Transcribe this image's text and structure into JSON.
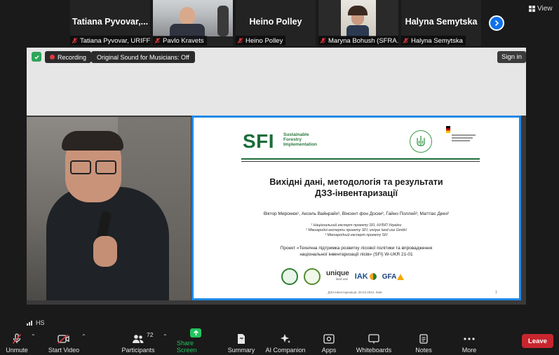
{
  "gallery": {
    "tiles": [
      {
        "big_name": "Tatiana  Pyvovar,...",
        "caption": "Tatiana Pyvovar, URIFF..."
      },
      {
        "big_name": "",
        "caption": "Pavlo Kravets"
      },
      {
        "big_name": "Heino Polley",
        "caption": "Heino Polley"
      },
      {
        "big_name": "",
        "caption": "Maryna Bohush (SFRA..."
      },
      {
        "big_name": "Halyna Semytska",
        "caption": "Halyna Semytska"
      }
    ],
    "view_label": "View"
  },
  "stage": {
    "recording_label": "Recording",
    "original_sound_label": "Original Sound for Musicians: Off",
    "signin_label": "Sign in",
    "hs_label": "HS"
  },
  "slide": {
    "logo_text": "SFI",
    "logo_sub": [
      "Sustainable",
      "Forestry",
      "Implementation"
    ],
    "title_line1": "Вихідні дані, методологія та результати",
    "title_line2": "ДЗЗ-інвентаризації",
    "authors": "Віктор Миронюк¹, Аксель Вайнрайх², Вінсент фон Доски², Гайно Поллей³, Маттіас Деез²",
    "affil1": "¹ Національний експерт проекту SFI, НУБіП України",
    "affil2": "² Міжнародні експерти проекту SFI, unique land use GmbH",
    "affil3": "³ Міжнародний експерт проекту SFI",
    "project_line1": "Проект «Технічна підтримка розвитку лісової політики та впровадження",
    "project_line2": "національної інвентаризації лісів»  (SFI) W-UKR 21-01",
    "footer_center": "ДЗЗ-інвентаризація, 26.04.2024, Київ",
    "page_number": "1",
    "partners": {
      "unique": "unique",
      "unique_sub": "land use",
      "iak": "IAK",
      "gfa": "GFA"
    }
  },
  "toolbar": {
    "unmute": "Unmute",
    "start_video": "Start Video",
    "participants": "Participants",
    "participants_count": "72",
    "share_screen": "Share Screen",
    "summary": "Summary",
    "ai_companion": "AI Companion",
    "apps": "Apps",
    "whiteboards": "Whiteboards",
    "notes": "Notes",
    "more": "More",
    "leave": "Leave"
  },
  "colors": {
    "share_green": "#22c55e",
    "leave_red": "#c8262f",
    "slide_border": "#1e88e5",
    "sfi_green": "#1b6d3a"
  }
}
